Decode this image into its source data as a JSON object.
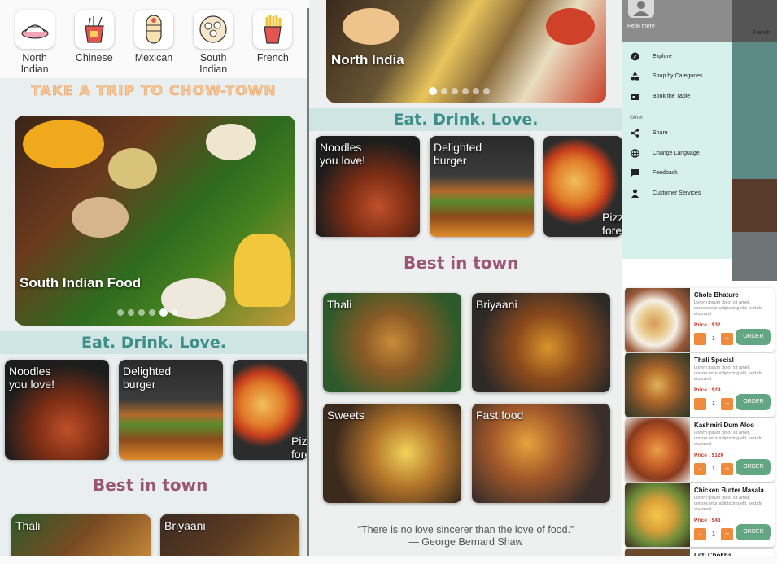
{
  "categories": [
    {
      "label": "North\nIndian",
      "icon": "thali-icon"
    },
    {
      "label": "Chinese",
      "icon": "noodle-box-icon"
    },
    {
      "label": "Mexican",
      "icon": "burrito-icon"
    },
    {
      "label": "South\nIndian",
      "icon": "idli-icon"
    },
    {
      "label": "French",
      "icon": "fries-icon"
    }
  ],
  "left": {
    "tagline": "TAKE A TRIP TO CHOW-TOWN",
    "hero_title": "South Indian Food",
    "band": "Eat. Drink. Love.",
    "promos": [
      "Noodles\nyou love!",
      "Delighted\nburger",
      "Pizz\nfore"
    ],
    "best_title": "Best in town",
    "tiles": [
      "Thali",
      "Briyaani"
    ]
  },
  "middle": {
    "hero_title": "North India",
    "band": "Eat. Drink. Love.",
    "promos": [
      "Noodles\nyou love!",
      "Delighted\nburger",
      "Pizz\nfore"
    ],
    "best_title": "Best in town",
    "tiles": [
      "Thali",
      "Briyaani",
      "Sweets",
      "Fast food"
    ],
    "quote": "“There is no love sincerer than the love of food.”",
    "author": "— George Bernard Shaw"
  },
  "drawer": {
    "greeting": "Hello there",
    "items": [
      {
        "label": "Explore",
        "icon": "compass-icon"
      },
      {
        "label": "Shop by Categories",
        "icon": "categories-icon"
      },
      {
        "label": "Book the Table",
        "icon": "calendar-icon"
      }
    ],
    "other_label": "Other",
    "other_items": [
      {
        "label": "Share",
        "icon": "share-icon"
      },
      {
        "label": "Change Language",
        "icon": "globe-icon"
      },
      {
        "label": "Feedback",
        "icon": "feedback-icon"
      },
      {
        "label": "Customer Services",
        "icon": "person-icon"
      }
    ],
    "peek_label": "French"
  },
  "products": [
    {
      "name": "Chole Bhature",
      "desc": "Lorem ipsum dolor sit amet, consectetur adipiscing elit, sed do eiusmod",
      "price": "Price : $32",
      "qty": "1",
      "minus": "-",
      "plus": "+",
      "order": "ORDER"
    },
    {
      "name": "Thali Special",
      "desc": "Lorem ipsum dolor sit amet, consectetur adipiscing elit, sed do eiusmod",
      "price": "Price : $29",
      "qty": "1",
      "minus": "-",
      "plus": "+",
      "order": "ORDER"
    },
    {
      "name": "Kashmiri Dum Aloo",
      "desc": "Lorem ipsum dolor sit amet, consectetur adipiscing elit, sed do eiusmod",
      "price": "Price : $120",
      "qty": "1",
      "minus": "-",
      "plus": "+",
      "order": "ORDER"
    },
    {
      "name": "Chicken Butter Masala",
      "desc": "Lorem ipsum dolor sit amet, consectetur adipiscing elit, sed do eiusmod",
      "price": "Price : $43",
      "qty": "1",
      "minus": "-",
      "plus": "+",
      "order": "ORDER"
    },
    {
      "name": "Litti Chokha"
    }
  ],
  "colors": {
    "accent": "#63a684",
    "orange": "#f08a3c",
    "band": "#cfe5e3",
    "band_text": "#3e8e89",
    "best": "#9a5673"
  }
}
